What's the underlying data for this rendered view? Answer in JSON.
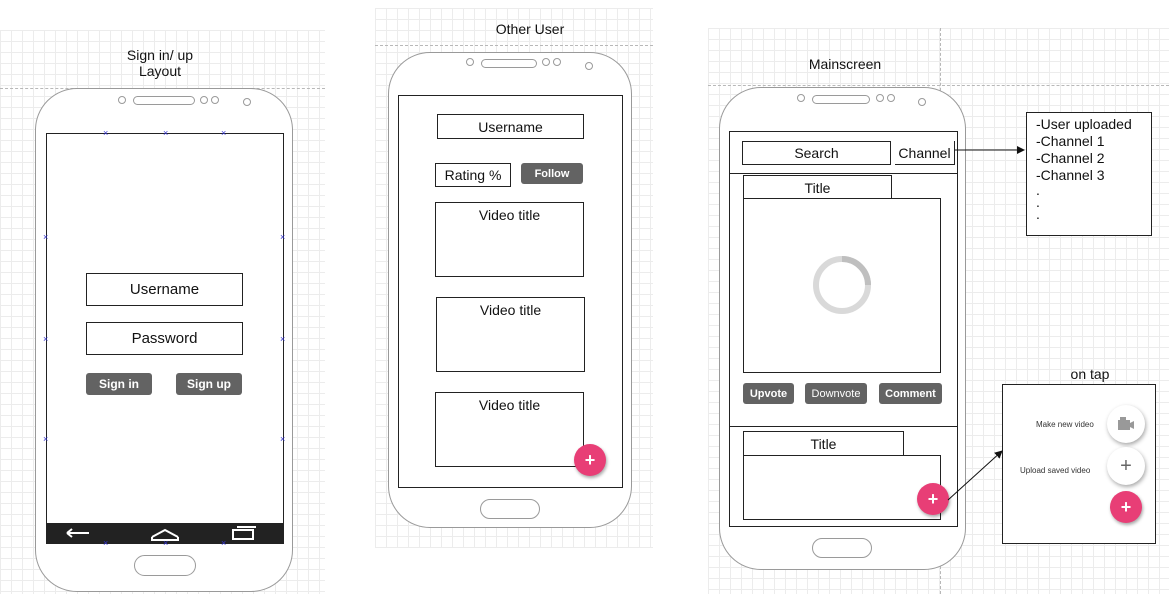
{
  "signin": {
    "title_line1": "Sign in/ up",
    "title_line2": "Layout",
    "username": "Username",
    "password": "Password",
    "signin_btn": "Sign in",
    "signup_btn": "Sign up"
  },
  "other_user": {
    "title": "Other User",
    "username": "Username",
    "rating": "Rating %",
    "follow_btn": "Follow",
    "video_titles": [
      "Video title",
      "Video title",
      "Video title"
    ],
    "fab": "+"
  },
  "mainscreen": {
    "title": "Mainscreen",
    "search": "Search",
    "channel": "Channel",
    "tab1": "Title",
    "tab2": "Title",
    "upvote": "Upvote",
    "downvote": "Downvote",
    "comment": "Comment",
    "fab": "+"
  },
  "channel_list": {
    "items": [
      "-User uploaded",
      "-Channel 1",
      "-Channel 2",
      "-Channel 3",
      ".",
      ".",
      "."
    ]
  },
  "on_tap": {
    "title": "on tap",
    "make_new": "Make new video",
    "upload_saved": "Upload saved video",
    "fab": "+",
    "plus": "+"
  },
  "colors": {
    "fab": "#e83e76",
    "button": "#636363",
    "outline": "#9a9a9a"
  }
}
